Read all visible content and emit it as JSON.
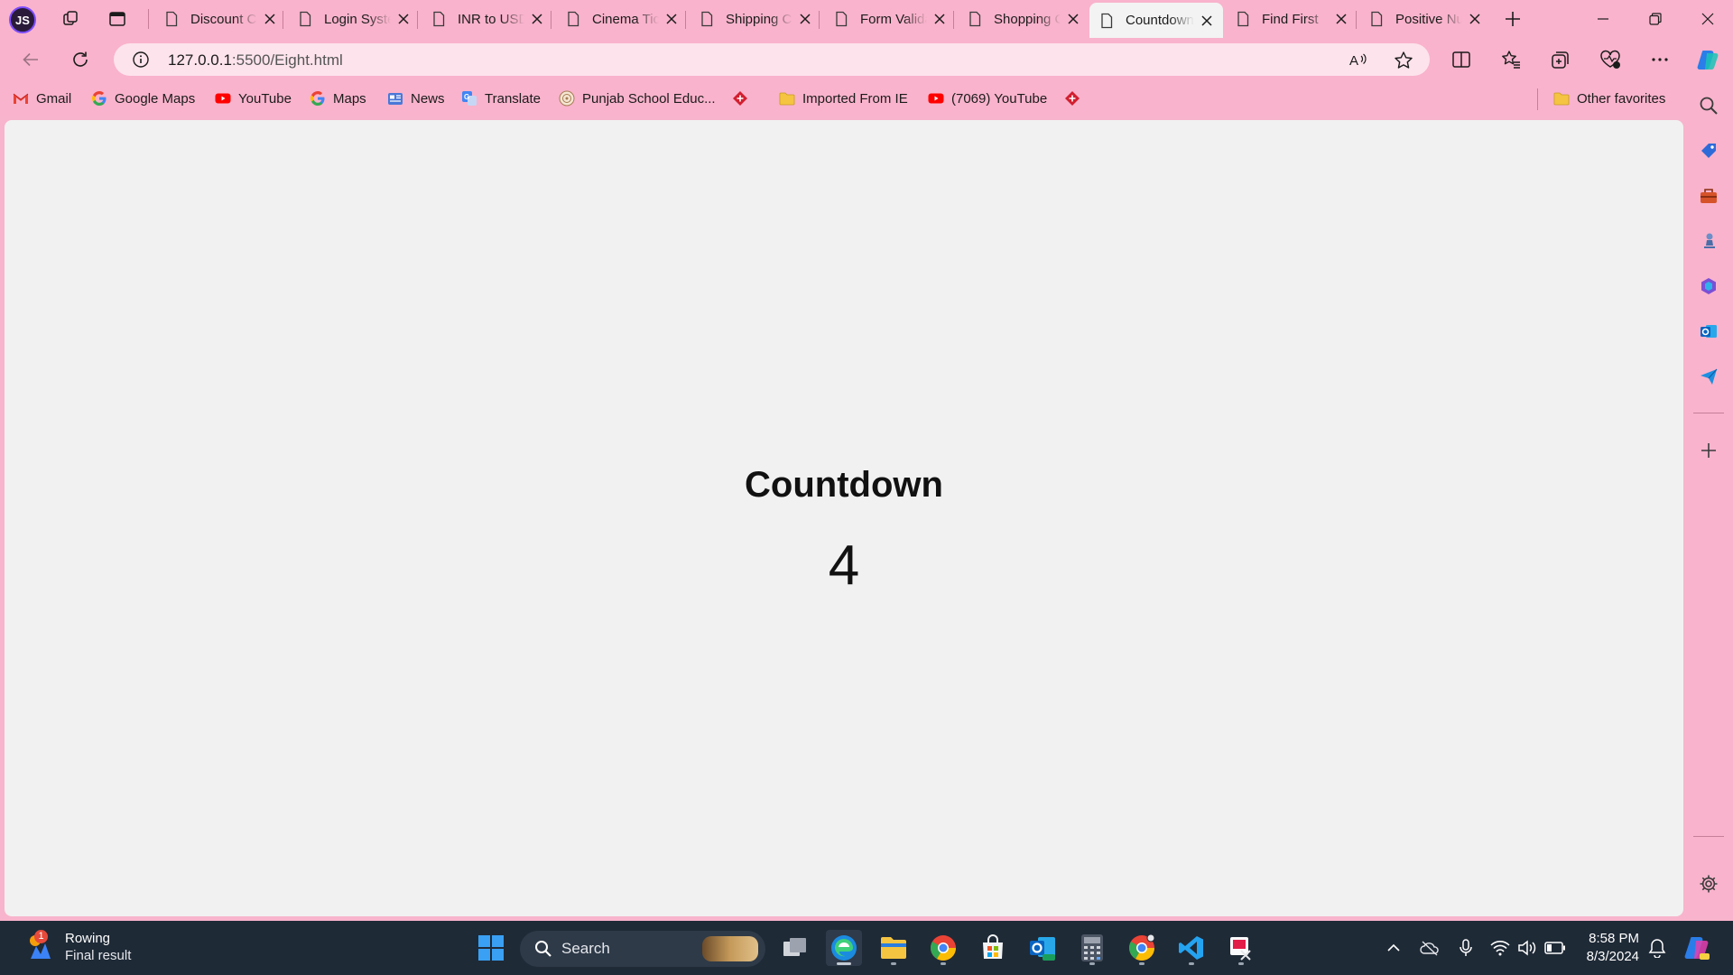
{
  "browser": {
    "profile_initials": "JS",
    "tabs": [
      {
        "title": "Discount Calculator",
        "active": false
      },
      {
        "title": "Login System",
        "active": false
      },
      {
        "title": "INR to USD",
        "active": false
      },
      {
        "title": "Cinema Ticket",
        "active": false
      },
      {
        "title": "Shipping Cost",
        "active": false
      },
      {
        "title": "Form Validation",
        "active": false
      },
      {
        "title": "Shopping Cart",
        "active": false
      },
      {
        "title": "Countdown",
        "active": true
      },
      {
        "title": "Find First",
        "active": false
      },
      {
        "title": "Positive Number",
        "active": false
      }
    ],
    "address": {
      "host": "127.0.0.1",
      "path": ":5500/Eight.html"
    },
    "favorites": [
      {
        "label": "Gmail",
        "icon": "gmail-icon"
      },
      {
        "label": "Google Maps",
        "icon": "google-icon"
      },
      {
        "label": "YouTube",
        "icon": "youtube-icon"
      },
      {
        "label": "Maps",
        "icon": "google-icon"
      },
      {
        "label": "News",
        "icon": "news-icon"
      },
      {
        "label": "Translate",
        "icon": "translate-icon"
      },
      {
        "label": "Punjab School Educ...",
        "icon": "seal-icon"
      },
      {
        "label": "",
        "icon": "diamond-icon"
      },
      {
        "label": "Imported From IE",
        "icon": "folder-icon"
      },
      {
        "label": "(7069) YouTube",
        "icon": "youtube-icon"
      },
      {
        "label": "",
        "icon": "diamond-icon"
      }
    ],
    "other_favorites": "Other favorites"
  },
  "page": {
    "heading": "Countdown",
    "value": "4"
  },
  "taskbar": {
    "weather_badge": "1",
    "weather_title": "Rowing",
    "weather_subtitle": "Final result",
    "search_placeholder": "Search",
    "time": "8:58 PM",
    "date": "8/3/2024"
  },
  "colors": {
    "chrome_pink": "#f9b3cc",
    "content_bg": "#f1f1f1",
    "taskbar_bg": "#1f2a37"
  }
}
